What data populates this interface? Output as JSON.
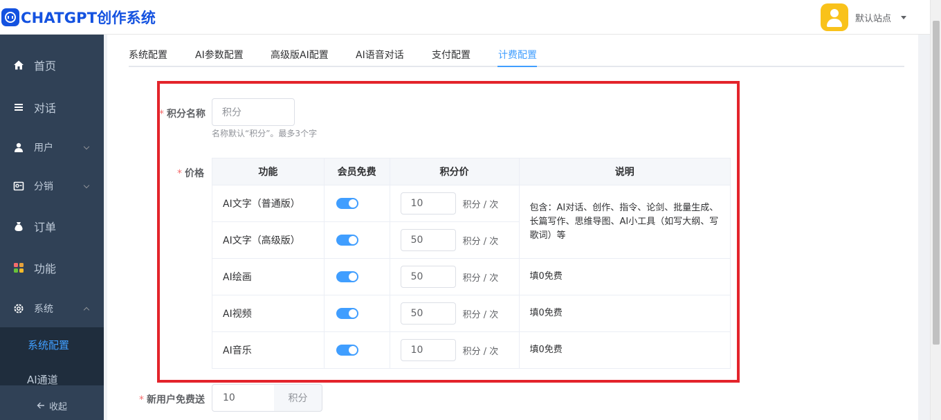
{
  "app": {
    "logo_text": "CHATGPT创作系统"
  },
  "header": {
    "user_name": "默认站点"
  },
  "sidebar": {
    "items": [
      {
        "label": "首页",
        "icon": "home-icon"
      },
      {
        "label": "对话",
        "icon": "list-icon"
      },
      {
        "label": "用户",
        "icon": "user-icon"
      },
      {
        "label": "分销",
        "icon": "distribution-icon"
      },
      {
        "label": "订单",
        "icon": "order-icon"
      },
      {
        "label": "功能",
        "icon": "grid-icon"
      },
      {
        "label": "系统",
        "icon": "gear-icon"
      }
    ],
    "submenu": [
      {
        "label": "系统配置",
        "active": true
      },
      {
        "label": "AI通道",
        "active": false
      }
    ],
    "collapse_label": "收起",
    "collapse_icon": "arrow-left-icon"
  },
  "tabs": [
    {
      "label": "系统配置",
      "active": false
    },
    {
      "label": "AI参数配置",
      "active": false
    },
    {
      "label": "高级版AI配置",
      "active": false
    },
    {
      "label": "AI语音对话",
      "active": false
    },
    {
      "label": "支付配置",
      "active": false
    },
    {
      "label": "计费配置",
      "active": true
    }
  ],
  "form": {
    "points_name": {
      "label": "积分名称",
      "value": "积分",
      "hint": "名称默认“积分”。最多3个字"
    },
    "price": {
      "label": "价格",
      "headers": [
        "功能",
        "会员免费",
        "积分价",
        "说明"
      ],
      "unit": "积分 / 次",
      "rows": [
        {
          "name": "AI文字（普通版）",
          "member_free": true,
          "price": "10"
        },
        {
          "name": "AI文字（高级版）",
          "member_free": true,
          "price": "50"
        },
        {
          "name": "AI绘画",
          "member_free": true,
          "price": "50"
        },
        {
          "name": "AI视频",
          "member_free": true,
          "price": "50"
        },
        {
          "name": "AI音乐",
          "member_free": true,
          "price": "10"
        }
      ],
      "desc_text": "包含：AI对话、创作、指令、论剑、批量生成、长篇写作、思维导图、AI小工具（如写大纲、写歌词）等",
      "desc_free": "填0免费"
    },
    "new_user": {
      "label": "新用户免费送",
      "value": "10",
      "suffix": "积分"
    }
  },
  "colors": {
    "accent": "#409eff",
    "sidebar_bg": "#304156",
    "highlight_box": "#e3242b",
    "logo": "#1452e0"
  }
}
